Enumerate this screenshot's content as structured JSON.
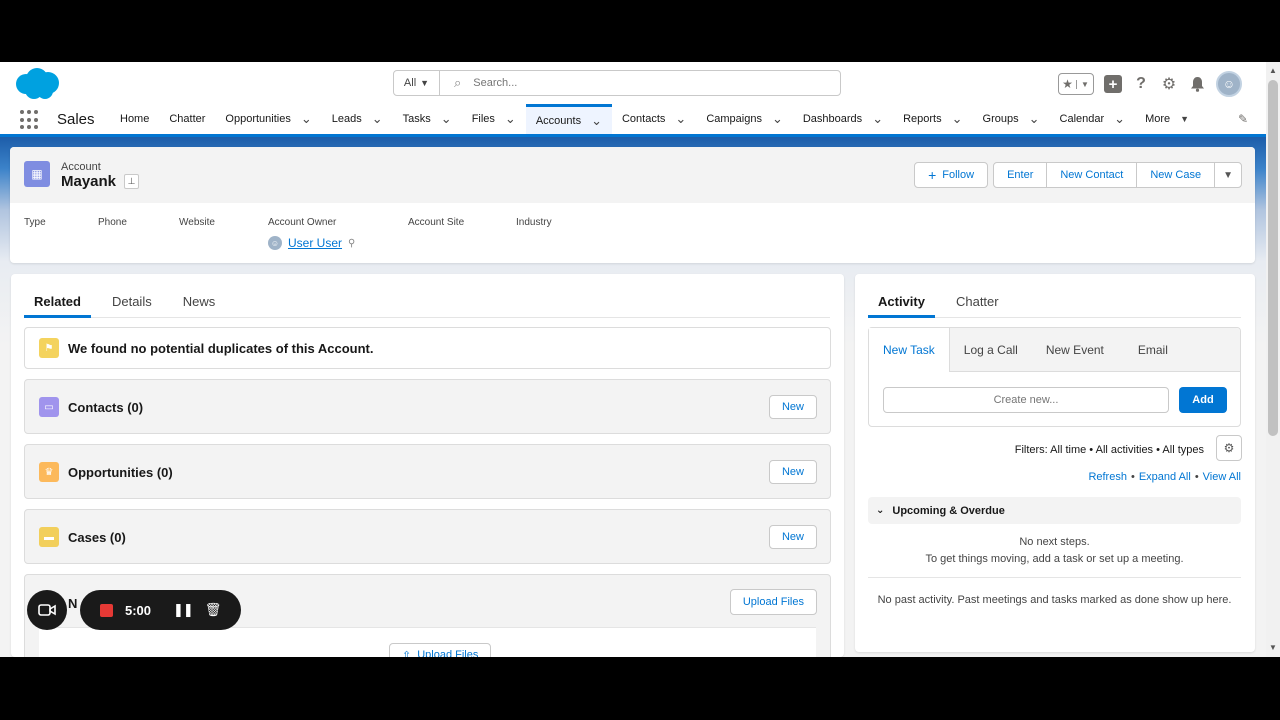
{
  "header": {
    "search_scope": "All",
    "search_placeholder": "Search..."
  },
  "nav": {
    "app_name": "Sales",
    "items": [
      {
        "label": "Home",
        "has_menu": false
      },
      {
        "label": "Chatter",
        "has_menu": false
      },
      {
        "label": "Opportunities",
        "has_menu": true
      },
      {
        "label": "Leads",
        "has_menu": true
      },
      {
        "label": "Tasks",
        "has_menu": true
      },
      {
        "label": "Files",
        "has_menu": true
      },
      {
        "label": "Accounts",
        "has_menu": true,
        "active": true
      },
      {
        "label": "Contacts",
        "has_menu": true
      },
      {
        "label": "Campaigns",
        "has_menu": true
      },
      {
        "label": "Dashboards",
        "has_menu": true
      },
      {
        "label": "Reports",
        "has_menu": true
      },
      {
        "label": "Groups",
        "has_menu": true
      },
      {
        "label": "Calendar",
        "has_menu": true
      },
      {
        "label": "More",
        "has_menu": true
      }
    ]
  },
  "record": {
    "object_label": "Account",
    "name": "Mayank",
    "actions": {
      "follow": "Follow",
      "enter": "Enter",
      "new_contact": "New Contact",
      "new_case": "New Case"
    },
    "fields": {
      "type_label": "Type",
      "phone_label": "Phone",
      "website_label": "Website",
      "owner_label": "Account Owner",
      "owner_value": "User User",
      "site_label": "Account Site",
      "industry_label": "Industry"
    }
  },
  "related": {
    "tabs": [
      "Related",
      "Details",
      "News"
    ],
    "duplicates_message": "We found no potential duplicates of this Account.",
    "cards": {
      "contacts": {
        "title": "Contacts (0)",
        "button": "New"
      },
      "opportunities": {
        "title": "Opportunities (0)",
        "button": "New"
      },
      "cases": {
        "title": "Cases (0)",
        "button": "New"
      },
      "notes": {
        "title": "N",
        "button": "Upload Files",
        "inner_button": "Upload Files"
      }
    }
  },
  "activity": {
    "tabs": [
      "Activity",
      "Chatter"
    ],
    "composer_tabs": [
      "New Task",
      "Log a Call",
      "New Event",
      "Email"
    ],
    "create_placeholder": "Create new...",
    "add_label": "Add",
    "filters": "Filters: All time • All activities • All types",
    "links": {
      "refresh": "Refresh",
      "expand": "Expand All",
      "view": "View All",
      "sep": "•"
    },
    "upcoming_label": "Upcoming & Overdue",
    "no_next_1": "No next steps.",
    "no_next_2": "To get things moving, add a task or set up a meeting.",
    "no_past": "No past activity. Past meetings and tasks marked as done show up here."
  },
  "recorder": {
    "time": "5:00"
  },
  "colors": {
    "brand": "#0176d3",
    "account_icon": "#7f8de1",
    "contacts_icon": "#a094ed",
    "opportunities_icon": "#fcb95b",
    "cases_icon": "#f2cf5b",
    "duplicates_icon": "#f4d35e",
    "recorder_dot": "#e53935"
  }
}
